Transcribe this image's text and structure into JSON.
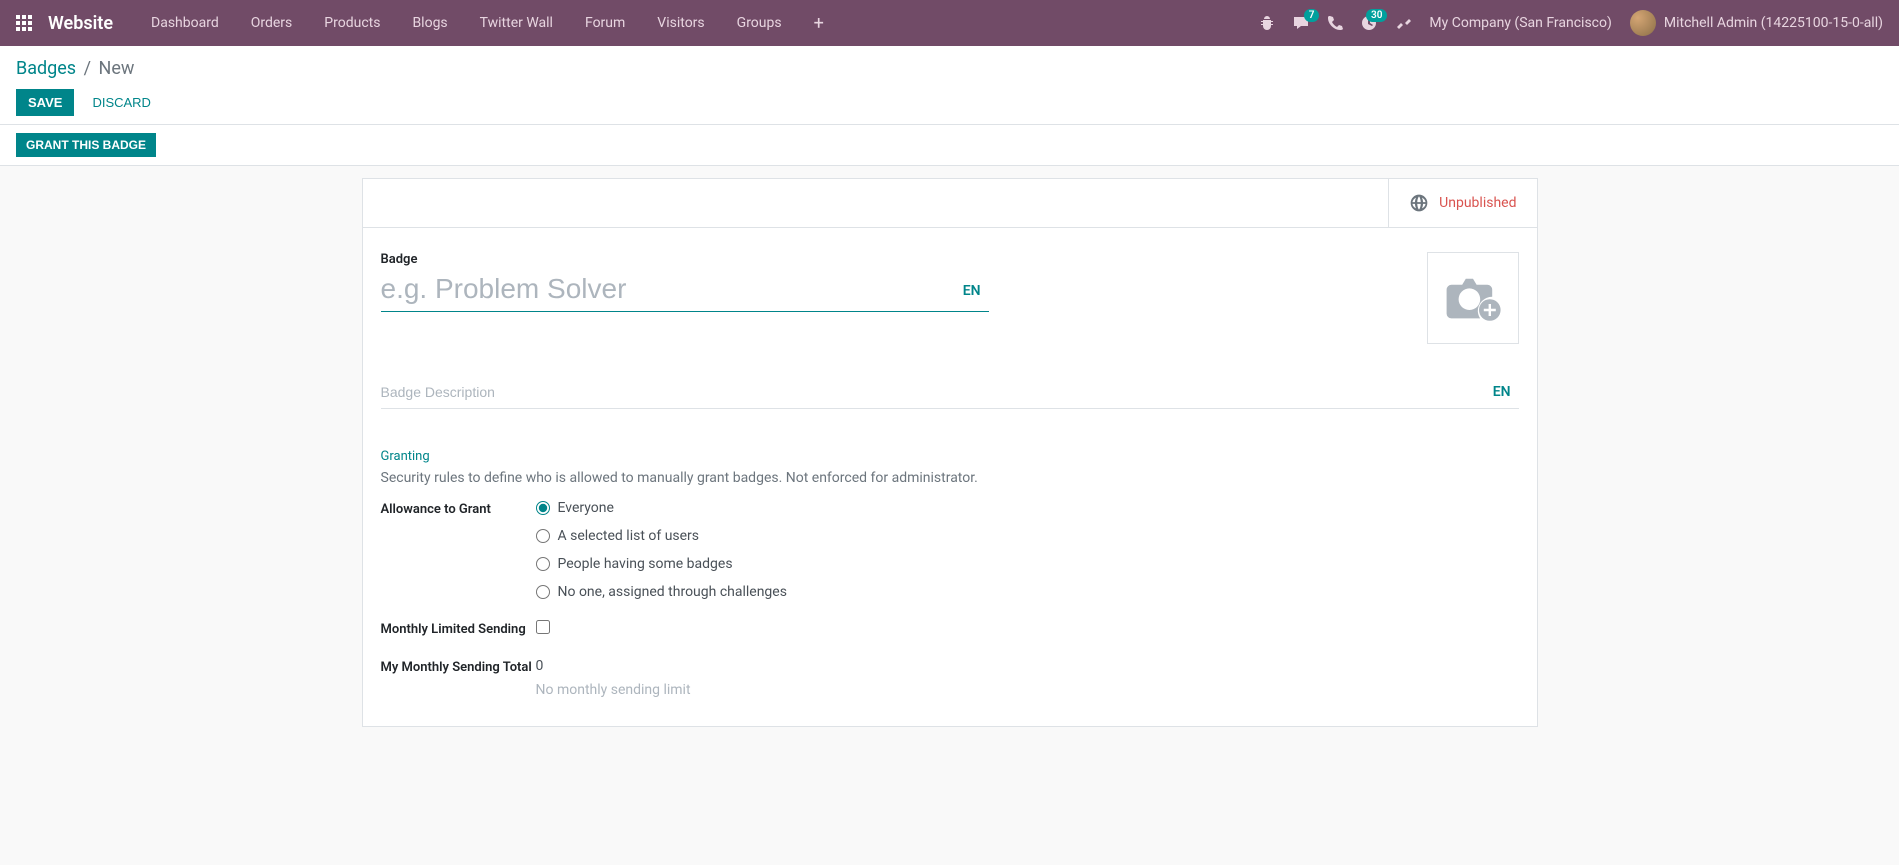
{
  "brand": "Website",
  "nav": {
    "items": [
      "Dashboard",
      "Orders",
      "Products",
      "Blogs",
      "Twitter Wall",
      "Forum",
      "Visitors",
      "Groups"
    ]
  },
  "systray": {
    "messages_count": "7",
    "activities_count": "30",
    "company": "My Company (San Francisco)",
    "user": "Mitchell Admin (14225100-15-0-all)"
  },
  "breadcrumb": {
    "parent": "Badges",
    "current": "New"
  },
  "buttons": {
    "save": "Save",
    "discard": "Discard",
    "grant": "Grant this Badge"
  },
  "status": {
    "unpublished": "Unpublished"
  },
  "form": {
    "badge_label": "Badge",
    "badge_placeholder": "e.g. Problem Solver",
    "lang": "EN",
    "desc_placeholder": "Badge Description",
    "granting_header": "Granting",
    "granting_desc": "Security rules to define who is allowed to manually grant badges. Not enforced for administrator.",
    "allowance_label": "Allowance to Grant",
    "allowance_options": {
      "everyone": "Everyone",
      "selected": "A selected list of users",
      "having": "People having some badges",
      "noone": "No one, assigned through challenges"
    },
    "monthly_limited_label": "Monthly Limited Sending",
    "monthly_total_label": "My Monthly Sending Total",
    "monthly_total_value": "0",
    "monthly_limit_hint": "No monthly sending limit"
  }
}
